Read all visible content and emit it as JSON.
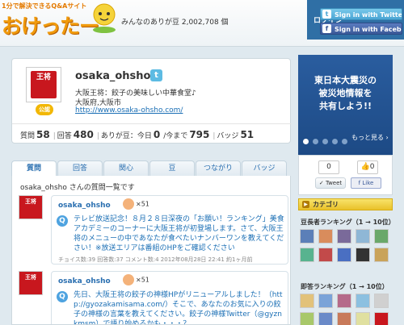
{
  "header": {
    "logo_tagline": "1分で解決できるQ&Aサイト",
    "logo": "おけったー",
    "counter_text": "みんなのありが豆 2,002,708 個",
    "login_label": "ログイン",
    "sign_twitter": "Sign in with Twitter",
    "sign_facebook": "Sign in with Facebook"
  },
  "profile": {
    "username": "osaka_ohsho",
    "avatar_text": "王将",
    "official_badge": "公認",
    "description": "大阪王将：餃子の美味しい中華食堂♪",
    "location": "大阪府,大阪市",
    "url": "http://www.osaka-ohsho.com/",
    "stats": {
      "questions_label": "質問",
      "questions_value": "58",
      "answers_label": "回答",
      "answers_value": "480",
      "beans_label": "ありが豆：今日",
      "beans_today": "0",
      "beans_total_label": "/今まで",
      "beans_total": "795",
      "badge_label": "バッジ",
      "badge_value": "51"
    }
  },
  "tabs": [
    "質問",
    "回答",
    "関心",
    "豆",
    "つながり",
    "バッジ"
  ],
  "active_tab": 0,
  "questions": {
    "heading": "osaka_ohsho さんの質問一覧です",
    "items": [
      {
        "author": "osaka_ohsho",
        "badge": "×51",
        "text": "テレビ放送記念！８月２８日深夜の「お願い！ランキング」美食アカデミーのコーナーに大阪王将が初登場します。さて、大阪王将のメニューの中であなたが食べたいナンバーワンを教えてください！※放送エリアは番組のHPをご確認ください",
        "meta": "チョイス数:39 回答数:37 コメント数:4 2012年08月28日 22:41 約1ヶ月前"
      },
      {
        "author": "osaka_ohsho",
        "badge": "×51",
        "text": "先日、大阪王将の餃子の神様HPがリニューアルしました！（http://gyozakamisama.com/）そこで、あなたのお気に入りの餃子の神様の言葉を教えてください。餃子の神様Twitter（@gyznkmsm）で語り始めるかも・・・？",
        "meta": ""
      }
    ]
  },
  "sidebar": {
    "banner_text_1": "東日本大震災の",
    "banner_text_2": "被災地情報を",
    "banner_text_3": "共有しよう!!",
    "banner_more": "もっと見る ›",
    "tweet_count": "0",
    "like_count": "0",
    "tweet_label": "Tweet",
    "like_label": "Like",
    "category_label": "カテゴリ",
    "rank1_title": "豆長者ランキング（1 → 10位）",
    "rank2_title": "即答ランキング（1 → 10位）"
  },
  "colors": {
    "accent": "#2f6fa5",
    "link": "#1b6fb5",
    "brand_orange": "#f09a0c",
    "ohsho_red": "#c8171e"
  }
}
